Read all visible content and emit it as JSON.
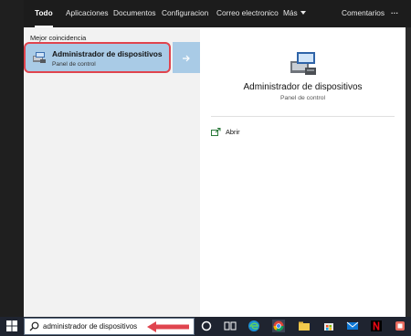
{
  "tabs": [
    {
      "label": "Todo",
      "active": true
    },
    {
      "label": "Aplicaciones",
      "active": false
    },
    {
      "label": "Documentos",
      "active": false
    },
    {
      "label": "Configuracion",
      "active": false
    },
    {
      "label": "Correo electronico",
      "active": false
    },
    {
      "label": "Más",
      "active": false
    }
  ],
  "header": {
    "feedback_label": "Comentarios",
    "more_label": "···"
  },
  "results": {
    "section_label": "Mejor coincidencia",
    "best_match": {
      "title": "Administrador de dispositivos",
      "subtitle": "Panel de control"
    }
  },
  "preview": {
    "title": "Administrador de dispositivos",
    "subtitle": "Panel de control",
    "actions": [
      {
        "label": "Abrir",
        "icon": "open-icon"
      }
    ]
  },
  "taskbar": {
    "search_value": "administrador de dispositivos",
    "icons": [
      "windows-start-icon",
      "search-icon",
      "cortana-icon",
      "task-view-icon",
      "edge-icon",
      "chrome-icon",
      "store-icon",
      "mail-icon",
      "netflix-icon",
      "app-icon"
    ]
  },
  "colors": {
    "highlight": "#a9cbe6",
    "annotation_red": "#e0444e",
    "taskbar": "#1f2430",
    "topbar": "#1c1c1c"
  }
}
